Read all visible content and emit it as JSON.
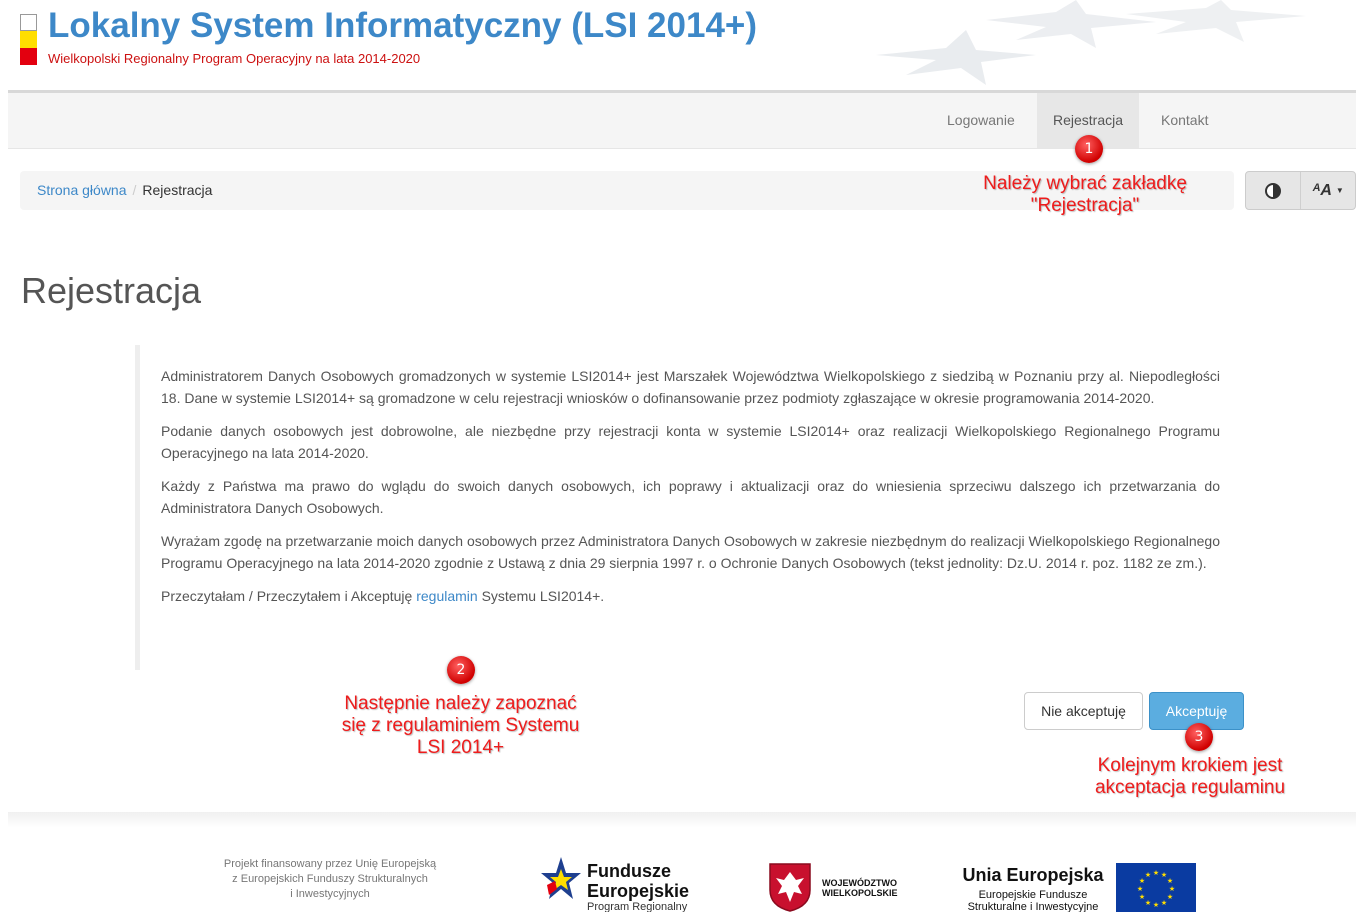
{
  "header": {
    "title": "Lokalny System Informatyczny (LSI 2014+)",
    "subtitle": "Wielkopolski Regionalny Program Operacyjny na lata 2014-2020"
  },
  "nav": {
    "items": [
      {
        "label": "Logowanie",
        "active": false
      },
      {
        "label": "Rejestracja",
        "active": true
      },
      {
        "label": "Kontakt",
        "active": false
      }
    ]
  },
  "breadcrumb": {
    "home": "Strona główna",
    "separator": "/",
    "current": "Rejestracja"
  },
  "toolbar": {
    "contrast_icon": "contrast-icon",
    "font_size_icon": "font-size-icon",
    "font_glyph": "ᴬA",
    "caret": "▼"
  },
  "page_title": "Rejestracja",
  "terms": {
    "p1": "Administratorem Danych Osobowych gromadzonych w systemie LSI2014+ jest Marszałek Województwa Wielkopolskiego z siedzibą w Poznaniu przy al. Niepodległości 18. Dane w systemie LSI2014+ są gromadzone w celu rejestracji wniosków o dofinansowanie przez podmioty zgłaszające w okresie programowania 2014-2020.",
    "p2": "Podanie danych osobowych jest dobrowolne, ale niezbędne przy rejestracji konta w systemie LSI2014+ oraz realizacji Wielkopolskiego Regionalnego Programu Operacyjnego na lata 2014-2020.",
    "p3": "Każdy z Państwa ma prawo do wglądu do swoich danych osobowych, ich poprawy i aktualizacji oraz do wniesienia sprzeciwu dalszego ich przetwarzania do Administratora Danych Osobowych.",
    "p4": "Wyrażam zgodę na przetwarzanie moich danych osobowych przez Administratora Danych Osobowych w zakresie niezbędnym do realizacji Wielkopolskiego Regionalnego Programu Operacyjnego na lata 2014-2020 zgodnie z Ustawą z dnia 29 sierpnia 1997 r. o Ochronie Danych Osobowych (tekst jednolity: Dz.U. 2014 r. poz. 1182 ze zm.).",
    "p5_before": "Przeczytałam / Przeczytałem i Akceptuję ",
    "p5_link": "regulamin",
    "p5_after": " Systemu LSI2014+."
  },
  "buttons": {
    "reject": "Nie akceptuję",
    "accept": "Akceptuję"
  },
  "annotations": {
    "marker_1": "1",
    "marker_2": "2",
    "marker_3": "3",
    "text_1_line1": "Należy wybrać zakładkę",
    "text_1_line2": "\"Rejestracja\"",
    "text_2_line1": "Następnie należy zapoznać",
    "text_2_line2": "się z regulaminiem Systemu",
    "text_2_line3": "LSI 2014+",
    "text_3_line1": "Kolejnym krokiem jest",
    "text_3_line2": "akceptacja regulaminu",
    "color": "#ee1c1c"
  },
  "footer": {
    "text_line1": "Projekt finansowany przez Unię Europejską",
    "text_line2": "z Europejskich Funduszy Strukturalnych",
    "text_line3": "i Inwestycyjnych",
    "fe_title_line1": "Fundusze",
    "fe_title_line2": "Europejskie",
    "fe_sub": "Program Regionalny",
    "wlkp_line1": "WOJEWÓDZTWO",
    "wlkp_line2": "WIELKOPOLSKIE",
    "ue_title": "Unia Europejska",
    "ue_sub_line1": "Europejskie Fundusze",
    "ue_sub_line2": "Strukturalne i Inwestycyjne"
  },
  "colors": {
    "brand_blue": "#3d88c8",
    "subtitle_red": "#cc1111",
    "accept_button": "#5bade0",
    "annotation_red": "#ee1c1c"
  }
}
